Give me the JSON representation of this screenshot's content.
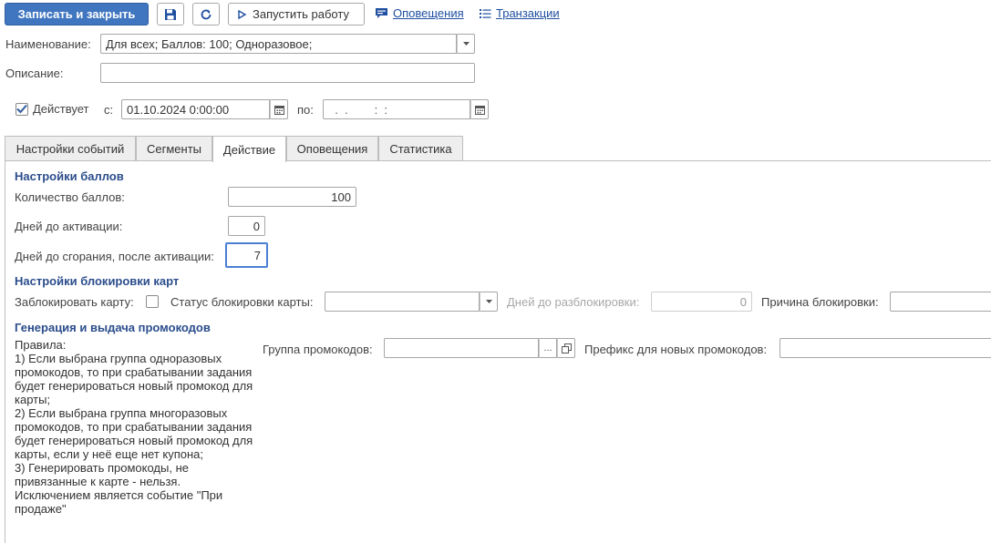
{
  "toolbar": {
    "save_close_label": "Записать и закрыть",
    "run_label": "Запустить работу",
    "notifications_link": "Оповещения",
    "transactions_link": "Транзакции"
  },
  "form": {
    "name_label": "Наименование:",
    "name_value": "Для всех; Баллов: 100; Одноразовое;",
    "description_label": "Описание:",
    "description_value": "",
    "active_label": "Действует",
    "active_checked": true,
    "from_label": "с:",
    "from_value": "01.10.2024  0:00:00",
    "to_label": "по:",
    "to_value": "  .  .        :  :"
  },
  "tabs": [
    {
      "label": "Настройки событий",
      "active": false
    },
    {
      "label": "Сегменты",
      "active": false
    },
    {
      "label": "Действие",
      "active": true
    },
    {
      "label": "Оповещения",
      "active": false
    },
    {
      "label": "Статистика",
      "active": false
    }
  ],
  "points": {
    "title": "Настройки баллов",
    "amount_label": "Количество баллов:",
    "amount_value": "100",
    "activation_days_label": "Дней до активации:",
    "activation_days_value": "0",
    "expiry_days_label": "Дней до сгорания, после активации:",
    "expiry_days_value": "7"
  },
  "blocking": {
    "title": "Настройки блокировки карт",
    "block_card_label": "Заблокировать карту:",
    "block_card_checked": false,
    "status_label": "Статус блокировки карты:",
    "status_value": "",
    "unblock_days_label": "Дней до разблокировки:",
    "unblock_days_value": "0",
    "reason_label": "Причина блокировки:",
    "reason_value": ""
  },
  "promo": {
    "title": "Генерация и выдача промокодов",
    "rules_text": "Правила:\n1) Если выбрана группа одноразовых промокодов, то при срабатывании задания будет генерироваться новый промокод для карты;\n2) Если выбрана группа многоразовых промокодов, то при срабатывании задания будет генерироваться новый промокод для карты, если у неё еще нет купона;\n3) Генерировать промокоды, не привязанные к карте - нельзя. Исключением является событие \"При продаже\"",
    "group_label": "Группа промокодов:",
    "group_value": "",
    "select_button": "...",
    "prefix_label": "Префикс для новых промокодов:",
    "prefix_value": ""
  },
  "colors": {
    "primary": "#4076c0",
    "link": "#1f4fa0",
    "section_title": "#2b4d8c",
    "focus": "#4a7fd4"
  },
  "icons": [
    "save-icon",
    "refresh-icon",
    "play-icon",
    "notifications-icon",
    "list-icon",
    "chevron-down-icon",
    "calendar-icon",
    "checkmark-icon",
    "open-icon"
  ]
}
